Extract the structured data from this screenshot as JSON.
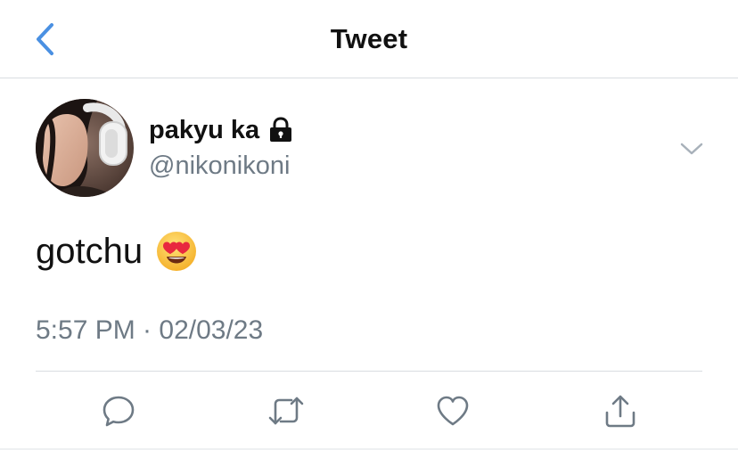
{
  "header": {
    "title": "Tweet",
    "back_icon": "chevron-left-icon",
    "accent_color": "#4a90e2"
  },
  "tweet": {
    "author": {
      "display_name": "pakyu ka",
      "handle": "@nikonikoni",
      "protected_icon": "lock-icon"
    },
    "text": "gotchu",
    "emoji_icon": "heart-eyes-emoji-icon",
    "timestamp": "5:57 PM · 02/03/23"
  },
  "actions": [
    {
      "name": "reply",
      "icon": "reply-icon"
    },
    {
      "name": "retweet",
      "icon": "retweet-icon"
    },
    {
      "name": "like",
      "icon": "heart-icon"
    },
    {
      "name": "share",
      "icon": "share-icon"
    }
  ],
  "colors": {
    "text_primary": "#111111",
    "text_secondary": "#6e7a85",
    "divider": "#d9dde1",
    "icon_gray": "#6e7a85"
  }
}
